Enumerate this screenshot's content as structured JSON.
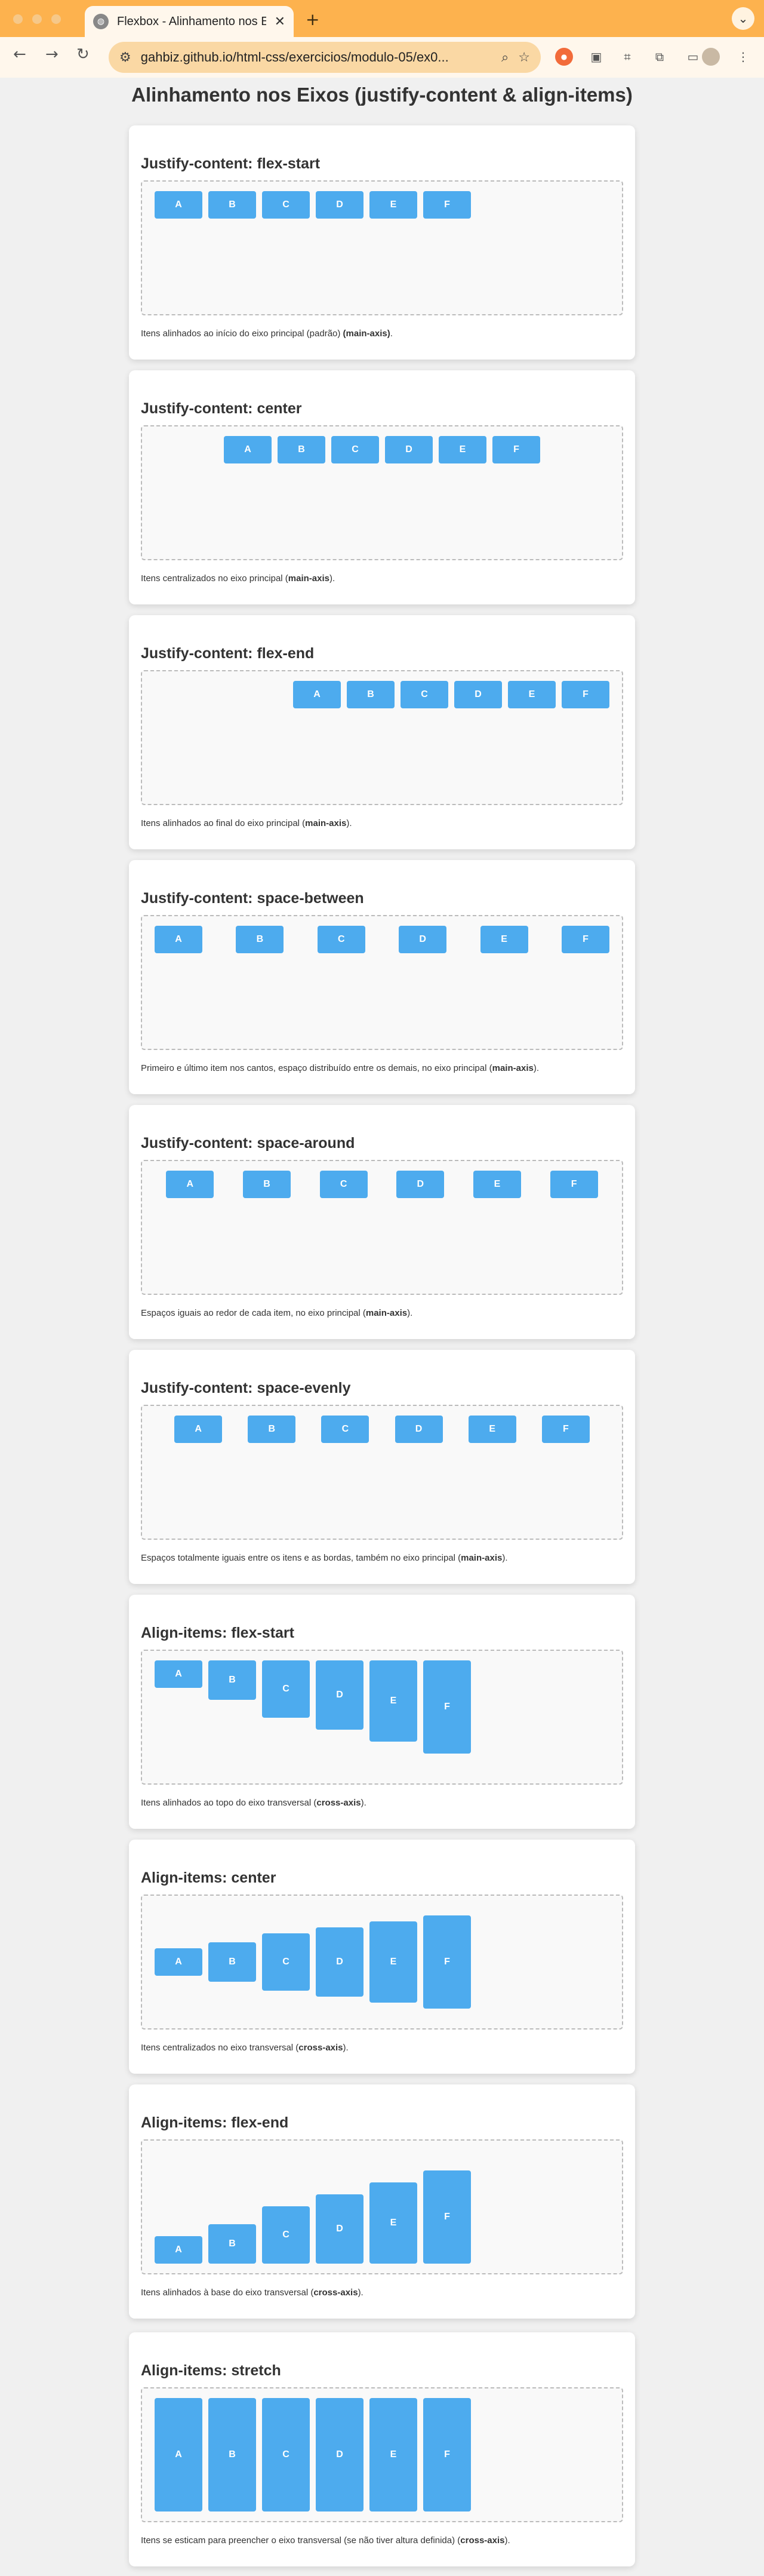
{
  "browser": {
    "tab_title": "Flexbox - Alinhamento nos Ei",
    "url": "gahbiz.github.io/html-css/exercicios/modulo-05/ex0..."
  },
  "page": {
    "title": "Alinhamento nos Eixos (justify-content & align-items)"
  },
  "item_labels": [
    "A",
    "B",
    "C",
    "D",
    "E",
    "F"
  ],
  "cards": [
    {
      "heading": "Justify-content: flex-start",
      "desc": "Itens alinhados ao início do eixo principal (padrão) ",
      "desc_strong": "(main-axis)",
      "desc_end": "."
    },
    {
      "heading": "Justify-content: center",
      "desc": "Itens centralizados no eixo principal (",
      "desc_strong": "main-axis",
      "desc_end": ")."
    },
    {
      "heading": "Justify-content: flex-end",
      "desc": "Itens alinhados ao final do eixo principal (",
      "desc_strong": "main-axis",
      "desc_end": ")."
    },
    {
      "heading": "Justify-content: space-between",
      "desc": "Primeiro e último item nos cantos, espaço distribuído entre os demais, no eixo principal (",
      "desc_strong": "main-axis",
      "desc_end": ")."
    },
    {
      "heading": "Justify-content: space-around",
      "desc": "Espaços iguais ao redor de cada item, no eixo principal (",
      "desc_strong": "main-axis",
      "desc_end": ")."
    },
    {
      "heading": "Justify-content: space-evenly",
      "desc": "Espaços totalmente iguais entre os itens e as bordas, também no eixo principal (",
      "desc_strong": "main-axis",
      "desc_end": ")."
    },
    {
      "heading": "Align-items: flex-start",
      "desc": "Itens alinhados ao topo do eixo transversal (",
      "desc_strong": "cross-axis",
      "desc_end": ")."
    },
    {
      "heading": "Align-items: center",
      "desc": "Itens centralizados no eixo transversal (",
      "desc_strong": "cross-axis",
      "desc_end": ")."
    },
    {
      "heading": "Align-items: flex-end",
      "desc": "Itens alinhados à base do eixo transversal (",
      "desc_strong": "cross-axis",
      "desc_end": ")."
    },
    {
      "heading": "Align-items: stretch",
      "desc": "Itens se esticam para preencher o eixo transversal (se não tiver altura definida) (",
      "desc_strong": "cross-axis",
      "desc_end": ")."
    }
  ]
}
